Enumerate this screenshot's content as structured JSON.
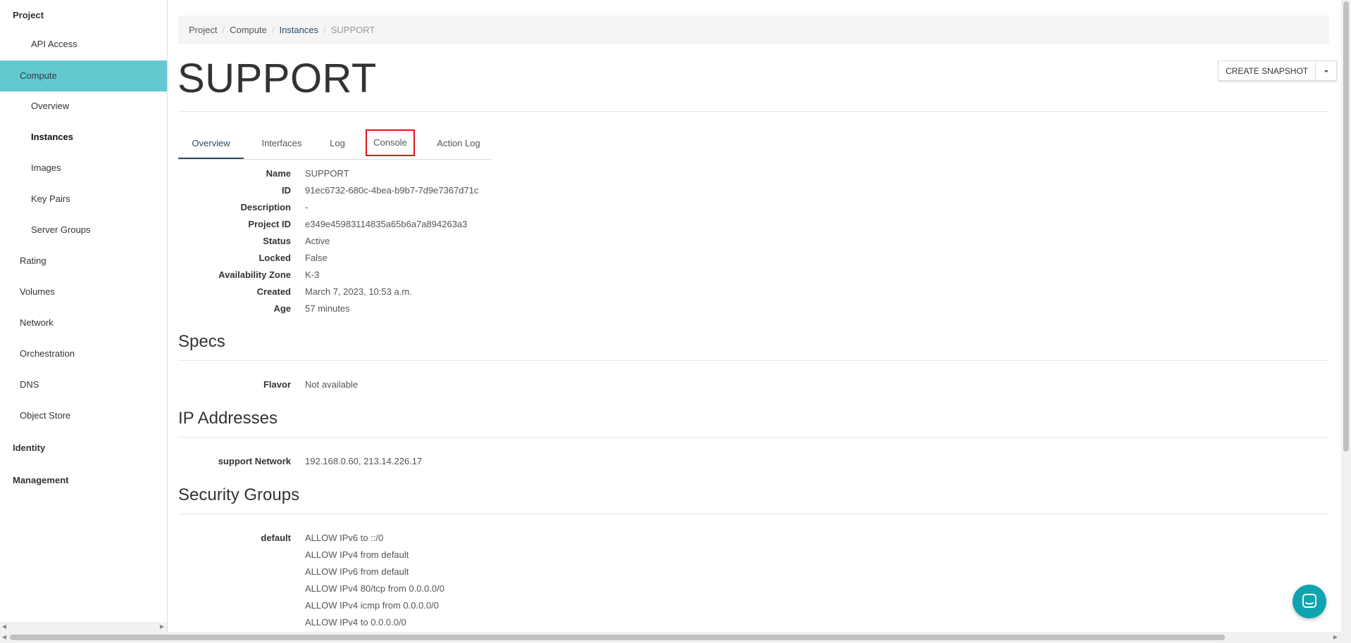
{
  "sidebar": {
    "items": [
      {
        "label": "Project"
      },
      {
        "label": "API Access"
      },
      {
        "label": "Compute"
      },
      {
        "label": "Overview"
      },
      {
        "label": "Instances"
      },
      {
        "label": "Images"
      },
      {
        "label": "Key Pairs"
      },
      {
        "label": "Server Groups"
      },
      {
        "label": "Rating"
      },
      {
        "label": "Volumes"
      },
      {
        "label": "Network"
      },
      {
        "label": "Orchestration"
      },
      {
        "label": "DNS"
      },
      {
        "label": "Object Store"
      },
      {
        "label": "Identity"
      },
      {
        "label": "Management"
      }
    ]
  },
  "breadcrumb": [
    "Project",
    "Compute",
    "Instances",
    "SUPPORT"
  ],
  "page_title": "SUPPORT",
  "actions": {
    "create_snapshot": "CREATE SNAPSHOT"
  },
  "tabs": [
    "Overview",
    "Interfaces",
    "Log",
    "Console",
    "Action Log"
  ],
  "overview": [
    {
      "label": "Name",
      "value": "SUPPORT"
    },
    {
      "label": "ID",
      "value": "91ec6732-680c-4bea-b9b7-7d9e7367d71c"
    },
    {
      "label": "Description",
      "value": "-"
    },
    {
      "label": "Project ID",
      "value": "e349e45983114835a65b6a7a894263a3"
    },
    {
      "label": "Status",
      "value": "Active"
    },
    {
      "label": "Locked",
      "value": "False"
    },
    {
      "label": "Availability Zone",
      "value": "K-3"
    },
    {
      "label": "Created",
      "value": "March 7, 2023, 10:53 a.m."
    },
    {
      "label": "Age",
      "value": "57 minutes"
    }
  ],
  "specs": {
    "title": "Specs",
    "rows": [
      {
        "label": "Flavor",
        "value": "Not available"
      }
    ]
  },
  "ip_addresses": {
    "title": "IP Addresses",
    "rows": [
      {
        "label": "support Network",
        "value": "192.168.0.60,  213.14.226.17"
      }
    ]
  },
  "security_groups": {
    "title": "Security Groups",
    "group_label": "default",
    "rules": [
      "ALLOW IPv6 to ::/0",
      "ALLOW IPv4 from default",
      "ALLOW IPv6 from default",
      "ALLOW IPv4 80/tcp from 0.0.0.0/0",
      "ALLOW IPv4 icmp from 0.0.0.0/0",
      "ALLOW IPv4 to 0.0.0.0/0"
    ]
  },
  "icons": {
    "chat": "chat-bubble-icon",
    "caret": "caret-down-icon"
  },
  "colors": {
    "active_nav": "#62c9d0",
    "link": "#2a4a66",
    "highlight": "#e0121b",
    "chat": "#10a4b0"
  }
}
